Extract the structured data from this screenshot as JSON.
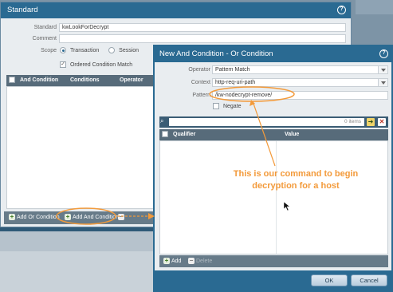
{
  "standard": {
    "title": "Standard",
    "fields": {
      "standard_label": "Standard",
      "standard_value": "kwLookForDecrypt",
      "comment_label": "Comment",
      "comment_value": "",
      "scope_label": "Scope",
      "scope_options": [
        "Transaction",
        "Session"
      ],
      "scope_selected": "Transaction",
      "ordered_label": "Ordered Condition Match",
      "ordered_checked": true
    },
    "table_headers": [
      "And Condition",
      "Conditions",
      "Operator"
    ],
    "footer": {
      "add_or_label": "Add Or Condition",
      "add_and_label": "Add And Condition"
    }
  },
  "dialog": {
    "title": "New And Condition - Or Condition",
    "operator_label": "Operator",
    "operator_value": "Pattern Match",
    "context_label": "Context",
    "context_value": "http-req-uri-path",
    "pattern_label": "Pattern",
    "pattern_value": "/kw-nodecrypt-remove/",
    "negate_label": "Negate",
    "items_count": "0 items",
    "table_headers": [
      "Qualifier",
      "Value"
    ],
    "footer": {
      "add_label": "Add",
      "delete_label": "Delete"
    },
    "ok_label": "OK",
    "cancel_label": "Cancel"
  },
  "annotation": {
    "line1": "This is our command to begin",
    "line2": "decryption for a host"
  },
  "colors": {
    "title_bar": "#2a6a92",
    "annotation": "#f39a3a",
    "table_header": "#576b7a"
  }
}
